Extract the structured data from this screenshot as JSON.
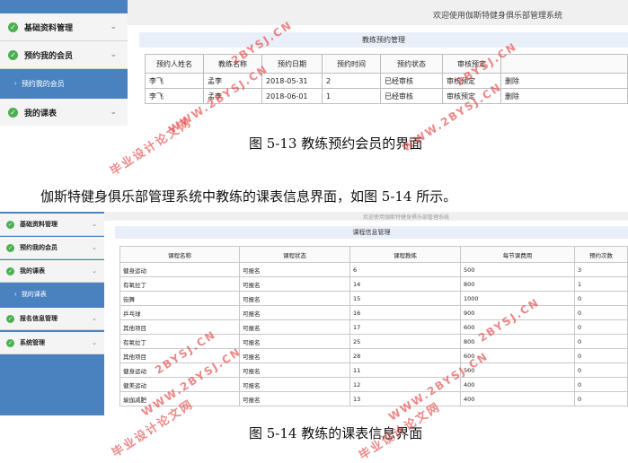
{
  "screenshot1": {
    "header_text": "欢迎使用伽斯特健身俱乐部管理系统",
    "panel_title": "教练预约管理",
    "sidebar": {
      "group1": "基础资料管理",
      "group2": "预约我的会员",
      "sub_item": "预约我的会员",
      "group3": "我的课表"
    },
    "table": {
      "columns": [
        "预约人姓名",
        "教练名称",
        "预约日期",
        "预约时间",
        "预约状态",
        "审核预定",
        ""
      ],
      "rows": [
        [
          "李飞",
          "孟李",
          "2018-05-31",
          "2",
          "已经审核",
          "审核预定",
          "删除"
        ],
        [
          "李飞",
          "孟李",
          "2018-06-01",
          "1",
          "已经审核",
          "审核预定",
          "删除"
        ]
      ]
    }
  },
  "caption1": "图 5-13  教练预约会员的界面",
  "paragraph": "伽斯特健身俱乐部管理系统中教练的课表信息界面，如图 5-14 所示。",
  "screenshot2": {
    "header_text": "欢迎使用伽斯特健身俱乐部管理系统",
    "panel_title": "课程信息管理",
    "sidebar": {
      "group1": "基础资料管理",
      "group2": "预约我的会员",
      "group3": "我的课表",
      "sub_item": "我的课表",
      "group4": "报名信息管理",
      "group5": "系统管理"
    },
    "table": {
      "columns": [
        "课程名称",
        "课程状态",
        "课程教练",
        "每节课费用",
        "预约次数"
      ],
      "rows": [
        [
          "健身运动",
          "可报名",
          "6",
          "500",
          "3"
        ],
        [
          "有氧拉丁",
          "可报名",
          "14",
          "800",
          "1"
        ],
        [
          "街舞",
          "可报名",
          "15",
          "1000",
          "0"
        ],
        [
          "乒乓球",
          "可报名",
          "16",
          "900",
          "0"
        ],
        [
          "其他项目",
          "可报名",
          "17",
          "600",
          "0"
        ],
        [
          "有氧拉丁",
          "可报名",
          "25",
          "800",
          "0"
        ],
        [
          "其他项目",
          "可报名",
          "28",
          "600",
          "0"
        ],
        [
          "健身运动",
          "可报名",
          "11",
          "500",
          "0"
        ],
        [
          "健美运动",
          "可报名",
          "12",
          "400",
          "0"
        ],
        [
          "瑜伽减肥",
          "可报名",
          "13",
          "400",
          "0"
        ]
      ]
    }
  },
  "caption2": "图 5-14  教练的课表信息界面",
  "watermarks": {
    "en": "WWW.2BYSJ.CN",
    "en_short": "2BYSJ.CN",
    "cn": "毕业设计论文网"
  },
  "colors": {
    "sidebar_blue": "#4a82c0",
    "check_green": "#4caf50",
    "watermark_red": "#e33a3a"
  },
  "icons": [
    "check-circle-icon",
    "chevron-down-icon",
    "arrow-right-icon"
  ]
}
